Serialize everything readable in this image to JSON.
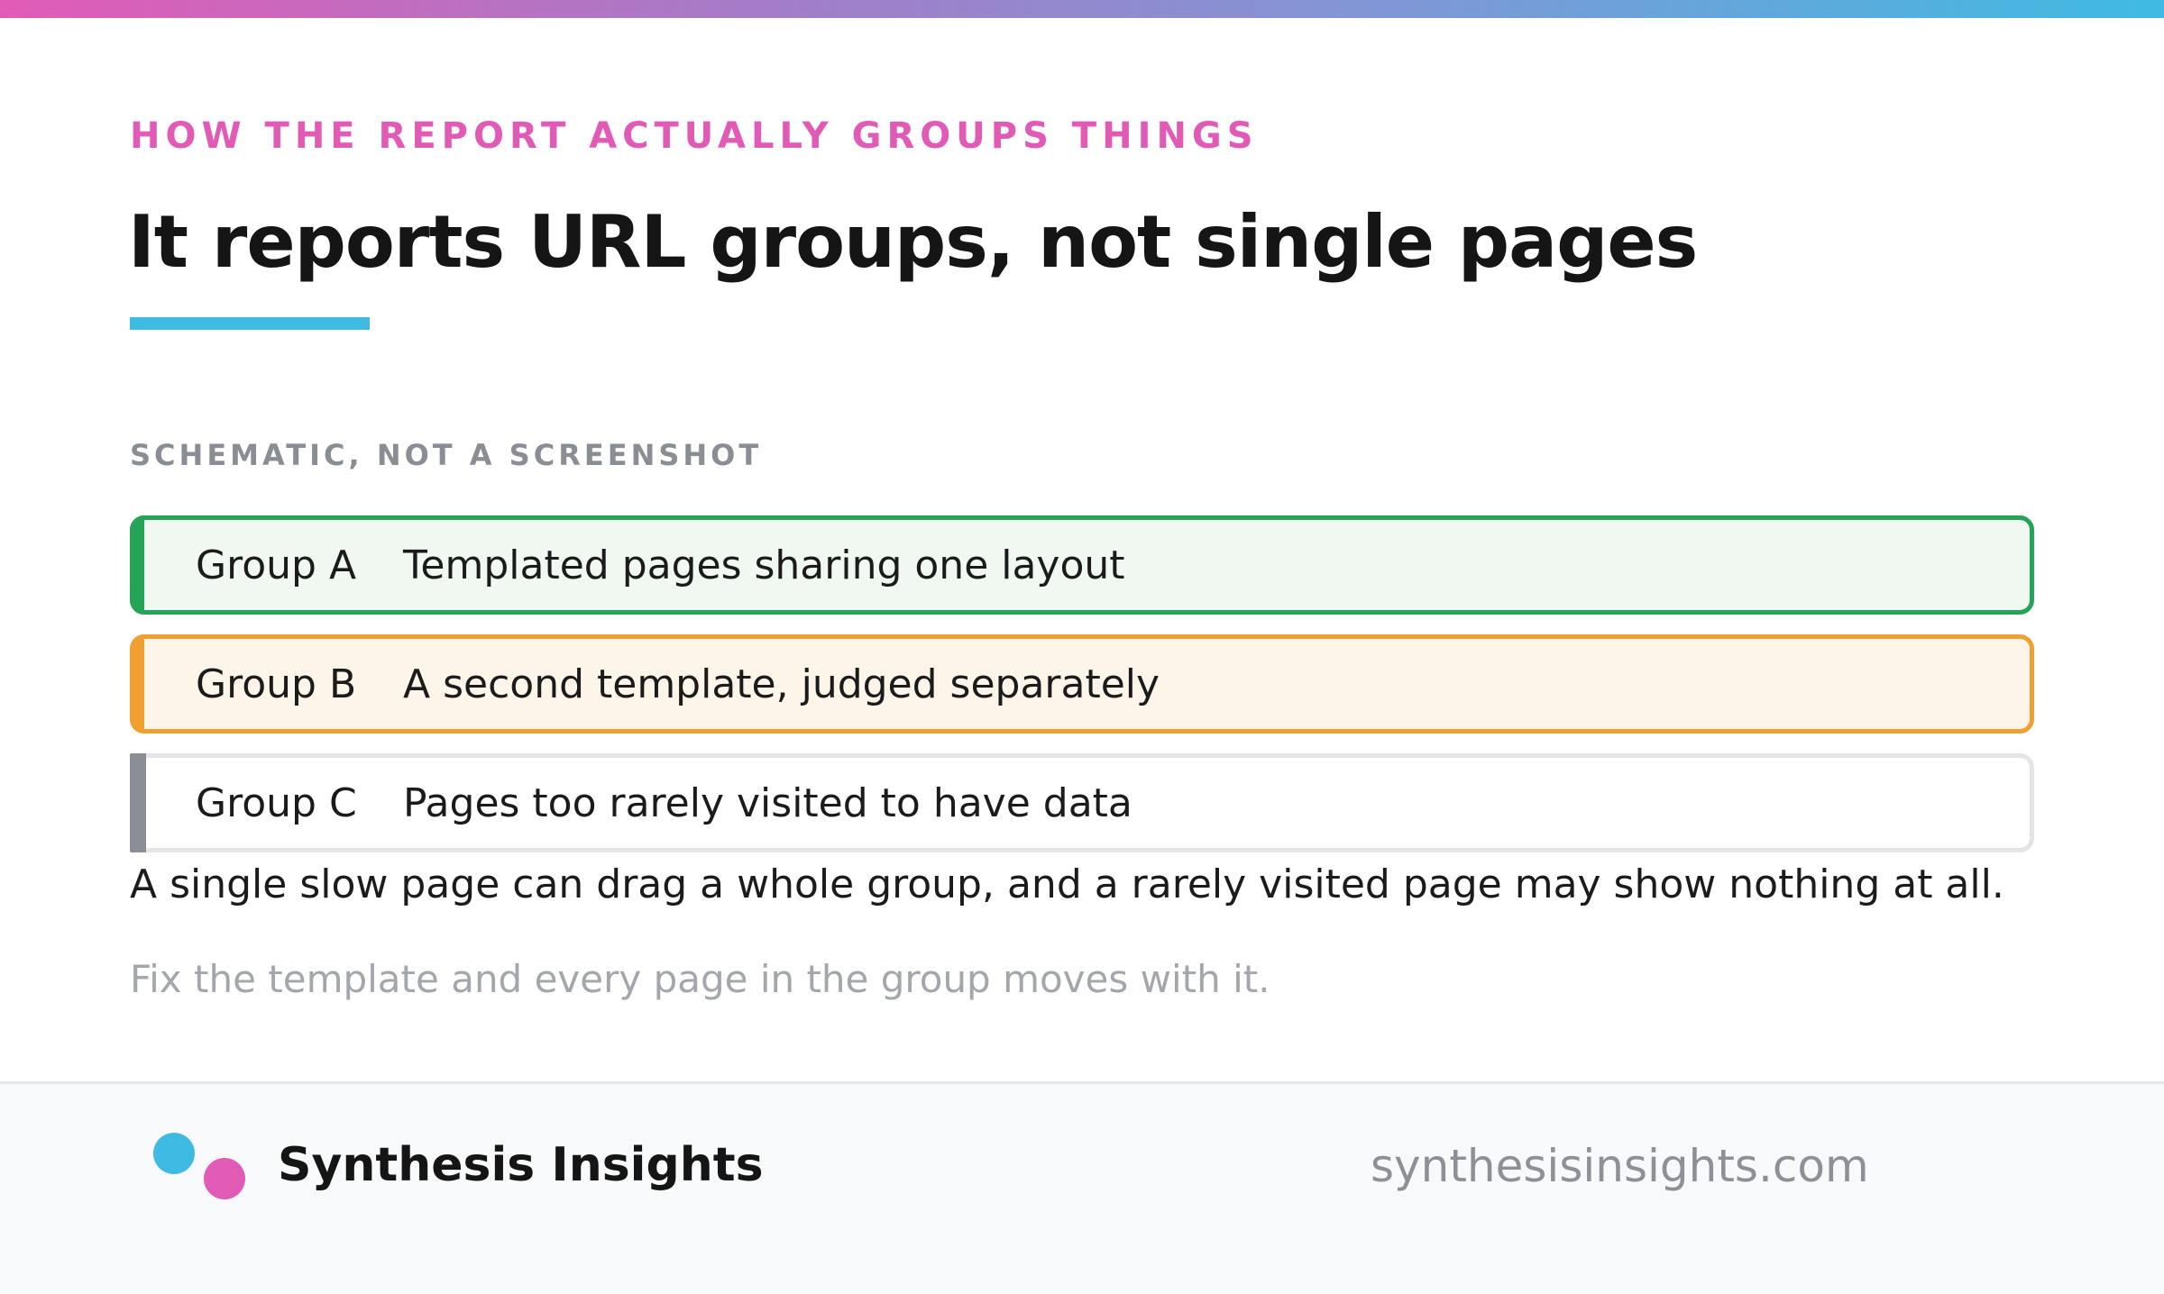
{
  "header": {
    "eyebrow": "HOW THE REPORT ACTUALLY GROUPS THINGS",
    "title": "It reports URL groups, not single pages"
  },
  "schematic_label": "SCHEMATIC, NOT A SCREENSHOT",
  "groups": [
    {
      "name": "Group A",
      "description": "Templated pages sharing one layout",
      "color": "#25a356"
    },
    {
      "name": "Group B",
      "description": "A second template, judged separately",
      "color": "#f0a030"
    },
    {
      "name": "Group C",
      "description": "Pages too rarely visited to have data",
      "color": "#8a8d93"
    }
  ],
  "note": "A single slow page can drag a whole group, and a rarely visited page may show nothing at all.",
  "subnote": "Fix the template and every page in the group moves with it.",
  "footer": {
    "brand": "Synthesis Insights",
    "site": "synthesisinsights.com"
  },
  "colors": {
    "accent_pink": "#e15bb6",
    "accent_blue": "#3fbbe2"
  }
}
